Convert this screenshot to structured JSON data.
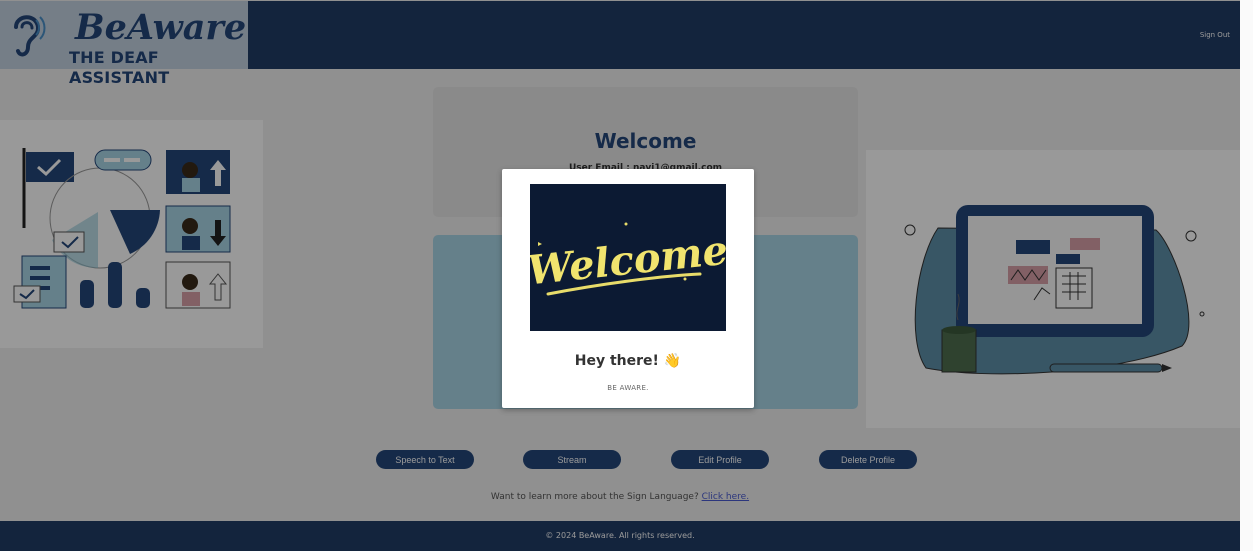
{
  "header": {
    "logo_name": "BeAware",
    "logo_tagline": "THE DEAF ASSISTANT",
    "sign_out_label": "Sign Out"
  },
  "welcome_card": {
    "title": "Welcome",
    "user_email": "User Email : navi1@gmail.com"
  },
  "buttons": {
    "speech_to_text": "Speech to Text",
    "stream": "Stream",
    "edit_profile": "Edit Profile",
    "delete_profile": "Delete Profile"
  },
  "learn_more": {
    "text": "Want to learn more about the Sign Language?",
    "link": "Click here."
  },
  "footer": {
    "copyright": "© 2024 BeAware. All rights reserved."
  },
  "modal": {
    "image_text": "Welcome",
    "greeting": "Hey there! 👋",
    "subtitle": "BE AWARE."
  },
  "colors": {
    "brand_navy": "#213d67",
    "accent_teal": "#a9d6e7",
    "logo_bg": "#c4d2e2"
  }
}
